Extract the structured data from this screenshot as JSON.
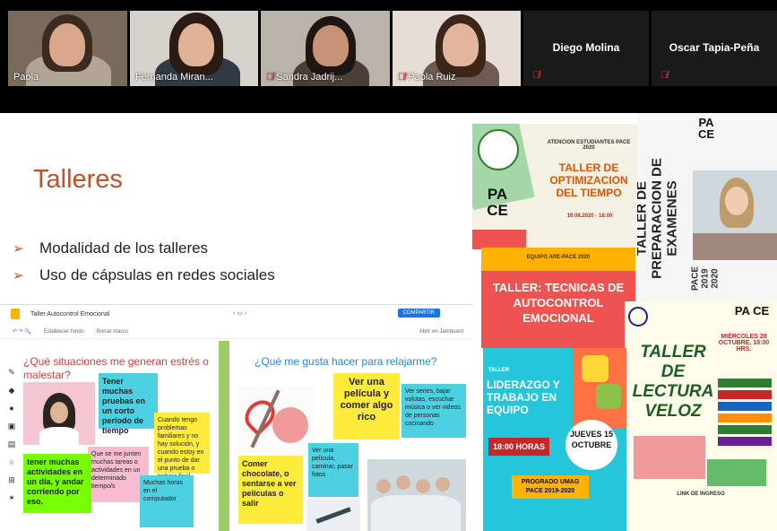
{
  "participants": [
    {
      "name": "Paola",
      "muted": false
    },
    {
      "name": "Fernanda Miran...",
      "muted": false
    },
    {
      "name": "Sandra Jadrij...",
      "muted": true
    },
    {
      "name": "Paola Ruiz",
      "muted": true
    },
    {
      "name": "Diego Molina",
      "muted": true
    },
    {
      "name": "Oscar Tapia-Peña",
      "muted": true
    }
  ],
  "slide": {
    "title": "Talleres",
    "bullets": [
      "Modalidad de los talleres",
      "Uso de cápsulas en redes sociales"
    ]
  },
  "jamboard": {
    "title": "Taller Autocontrol Emocional",
    "share_label": "COMPARTIR",
    "toolbar": [
      "Establecer fondo",
      "Borrar marco"
    ],
    "right_toolbar": "Abrir en Jamboard",
    "question_left": "¿Qué situaciones me generan estrés o malestar?",
    "question_right": "¿Qué me gusta hacer para relajarme?",
    "notes_left": [
      "Tener muchas pruebas en un corto período de tiempo",
      "Cuando tengo problemas familiares y no hay solución, y cuando estoy en el punto de dar una prueba o trabajo final",
      "Que se me junten muchas tareas o actividades en un determinado tiempo/s",
      "tener muchas actividades en un día, y andar corriendo por eso.",
      "Muchas horas en el computador"
    ],
    "notes_right": [
      "Ver una película y comer algo rico",
      "Ver series, bajar volutas, escuchar música o ver videos de personas cocinando",
      "Ver una película, caminar, pasar fotos",
      "Comer chocolate, o sentarse a ver películas o salir"
    ]
  },
  "posters": {
    "p1": {
      "top": "ATENCION ESTUDIANTES PACE 2020",
      "title": "TALLER DE OPTIMIZACION DEL TIEMPO",
      "brand": "PA CE",
      "date": "19.08.2020 · 18:00"
    },
    "p2": {
      "brand": "PA CE",
      "title": "TALLER DE PREPARACION DE EXAMENES",
      "side": "PACE 2019 2020"
    },
    "p3": {
      "top": "EQUIPO ARE-PACE 2020",
      "title": "TALLER: TECNICAS DE AUTOCONTROL EMOCIONAL"
    },
    "p4": {
      "brand": "PA CE",
      "title": "TALLER DE LECTURA VELOZ",
      "date": "MIÉRCOLES 28 OCTUBRE, 18:00 HRS.",
      "footer": "LINK DE INGRESO"
    },
    "p5": {
      "tag": "TALLER",
      "title": "LIDERAZGO Y TRABAJO EN EQUIPO",
      "time": "18:00 HORAS",
      "day": "JUEVES 15 OCTUBRE",
      "program": "PROGRADO UMAG PACE 2019-2020"
    }
  }
}
